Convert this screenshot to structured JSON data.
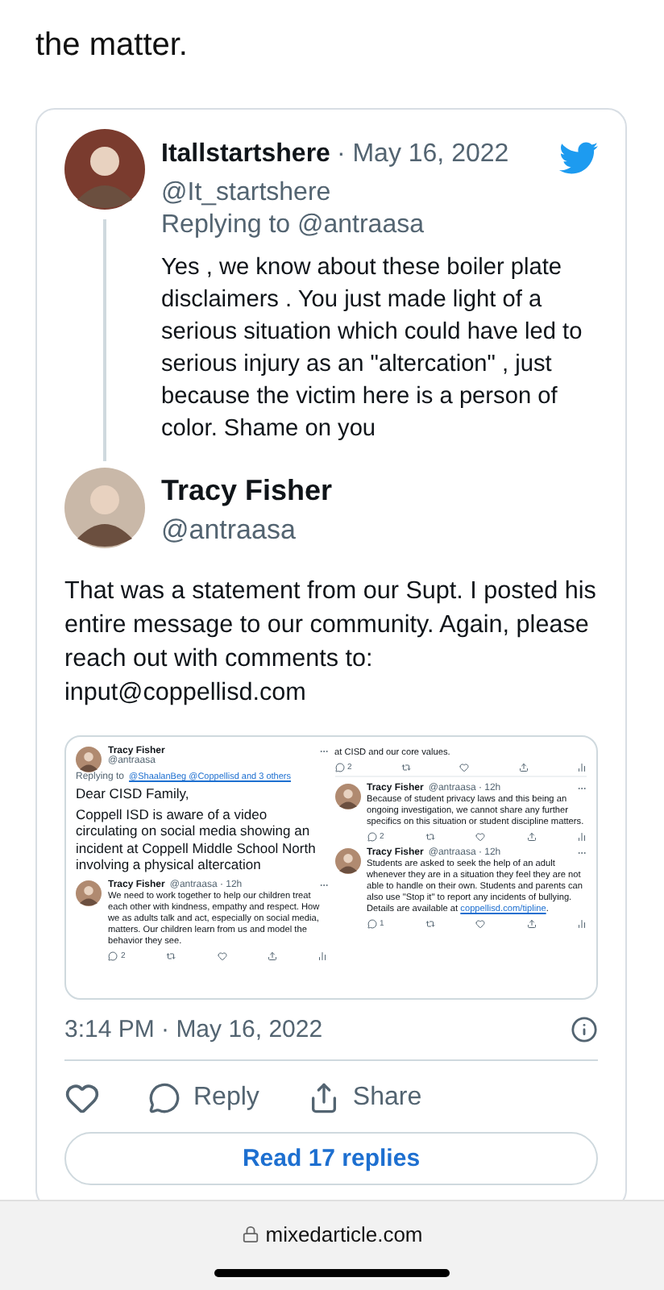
{
  "article_text": "the matter.",
  "embed": {
    "reply": {
      "name": "Itallstartshere",
      "date": "· May 16, 2022",
      "handle": "@It_startshere",
      "replying_to": "Replying to @antraasa",
      "text": "Yes ,  we know about these boiler plate disclaimers . You just made light of a serious situation which could have led to serious injury as an \"altercation\" , just because the victim here is a person of color. Shame on you"
    },
    "main": {
      "name": "Tracy Fisher",
      "handle": "@antraasa",
      "text": "That was a statement from our Supt. I posted his entire message to our community. Again, please reach out with comments to: input@coppellisd.com",
      "screenshot": {
        "columns": [
          {
            "items": [
              {
                "kind": "lead",
                "name": "Tracy Fisher",
                "handle": "@antraasa",
                "replying_prefix": "Replying to",
                "replying_links": "@ShaalanBeg @Coppellisd and 3 others",
                "greeting": "Dear CISD Family,",
                "text": "Coppell ISD is aware of a video circulating on social media showing an incident at Coppell Middle School North involving a physical altercation"
              },
              {
                "kind": "tweet",
                "name": "Tracy Fisher",
                "handle": "@antraasa · 12h",
                "text": "We need to work together to help our children treat each other with kindness, empathy and respect. How we as adults talk and act, especially on social media, matters. Our children learn from us and model the behavior they see.",
                "reply_count": "2"
              }
            ]
          },
          {
            "items": [
              {
                "kind": "fragment",
                "text": "at CISD and our core values.",
                "reply_count": "2"
              },
              {
                "kind": "tweet",
                "name": "Tracy Fisher",
                "handle": "@antraasa · 12h",
                "text": "Because of student privacy laws and this being an ongoing investigation, we cannot share any further specifics on this situation or student discipline matters.",
                "reply_count": "2"
              },
              {
                "kind": "tweet",
                "name": "Tracy Fisher",
                "handle": "@antraasa · 12h",
                "text": "Students are asked to seek the help of an adult whenever they are in a situation they feel they are not able to handle on their own. Students and parents can also use \"Stop it\" to report any incidents of bullying. Details are available at",
                "link": "coppellisd.com/tipline",
                "after_link": ".",
                "reply_count": "1"
              }
            ]
          }
        ]
      },
      "timestamp": "3:14 PM · May 16, 2022",
      "actions": {
        "reply": "Reply",
        "share": "Share"
      },
      "read_replies": "Read 17 replies"
    }
  },
  "browser": {
    "address": "mixedarticle.com"
  }
}
